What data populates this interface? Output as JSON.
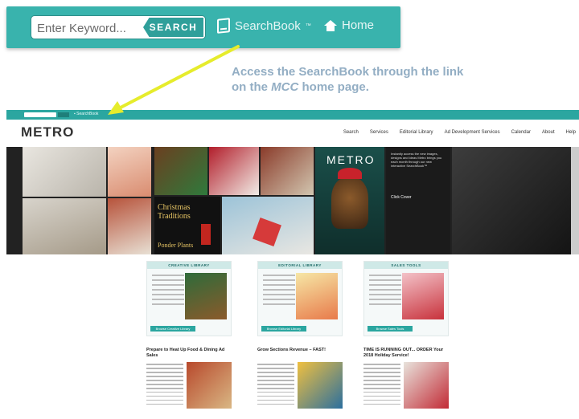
{
  "header": {
    "keyword_placeholder": "Enter Keyword...",
    "search_label": "SEARCH",
    "searchbook_label": "SearchBook",
    "home_label": "Home"
  },
  "annotation": {
    "line1": "Access the SearchBook through the link",
    "line2_pre": "on the ",
    "line2_em": "MCC",
    "line2_post": " home page."
  },
  "site": {
    "logo": "METRO",
    "nav": [
      "Search",
      "Services",
      "Editorial Library",
      "Ad Development Services",
      "Calendar",
      "About",
      "Help"
    ],
    "mosaic": {
      "christmas_title": "Christmas\nTraditions",
      "ponder": "Ponder Plants",
      "metro_cover": "METRO",
      "side_text": "Instantly access the new images, designs and ideas Metro brings you each month through our new interactive SearchBook™",
      "click_label": "Click Cover"
    },
    "cards": [
      {
        "title": "CREATIVE LIBRARY",
        "button": "Browse Creative Library"
      },
      {
        "title": "EDITORIAL LIBRARY",
        "button": "Browse Editorial Library"
      },
      {
        "title": "SALES TOOLS",
        "button": "Browse Sales Tools"
      }
    ],
    "articles": [
      {
        "title": "Prepare to Heat Up Food & Dining Ad Sales"
      },
      {
        "title": "Grow Sections Revenue – FAST!"
      },
      {
        "title": "TIME IS RUNNING OUT... ORDER Your 2018 Holiday Service!"
      }
    ]
  },
  "colors": {
    "teal": "#39b3ad",
    "callout": "#93aec4",
    "arrow": "#e6ec2c"
  }
}
